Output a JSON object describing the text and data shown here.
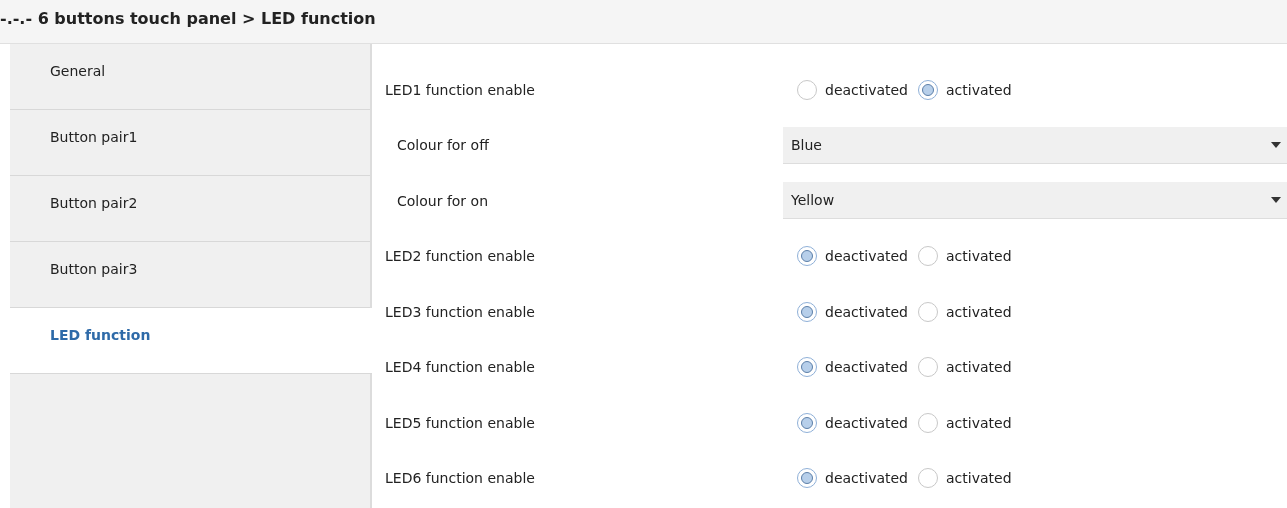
{
  "breadcrumb": "-.-.- 6 buttons touch panel > LED function",
  "sidebar": {
    "items": [
      {
        "label": "General",
        "selected": false
      },
      {
        "label": "Button pair1",
        "selected": false
      },
      {
        "label": "Button pair2",
        "selected": false
      },
      {
        "label": "Button pair3",
        "selected": false
      },
      {
        "label": "LED function",
        "selected": true
      }
    ]
  },
  "parameters": [
    {
      "kind": "radio",
      "label": "LED1 function enable",
      "options": [
        {
          "label": "deactivated",
          "selected": false
        },
        {
          "label": "activated",
          "selected": true
        }
      ]
    },
    {
      "kind": "dropdown",
      "label": "Colour for off",
      "value": "Blue"
    },
    {
      "kind": "dropdown",
      "label": "Colour for on",
      "value": "Yellow"
    },
    {
      "kind": "radio",
      "label": "LED2 function enable",
      "options": [
        {
          "label": "deactivated",
          "selected": true
        },
        {
          "label": "activated",
          "selected": false
        }
      ]
    },
    {
      "kind": "radio",
      "label": "LED3 function enable",
      "options": [
        {
          "label": "deactivated",
          "selected": true
        },
        {
          "label": "activated",
          "selected": false
        }
      ]
    },
    {
      "kind": "radio",
      "label": "LED4 function enable",
      "options": [
        {
          "label": "deactivated",
          "selected": true
        },
        {
          "label": "activated",
          "selected": false
        }
      ]
    },
    {
      "kind": "radio",
      "label": "LED5 function enable",
      "options": [
        {
          "label": "deactivated",
          "selected": true
        },
        {
          "label": "activated",
          "selected": false
        }
      ]
    },
    {
      "kind": "radio",
      "label": "LED6 function enable",
      "options": [
        {
          "label": "deactivated",
          "selected": true
        },
        {
          "label": "activated",
          "selected": false
        }
      ]
    }
  ]
}
